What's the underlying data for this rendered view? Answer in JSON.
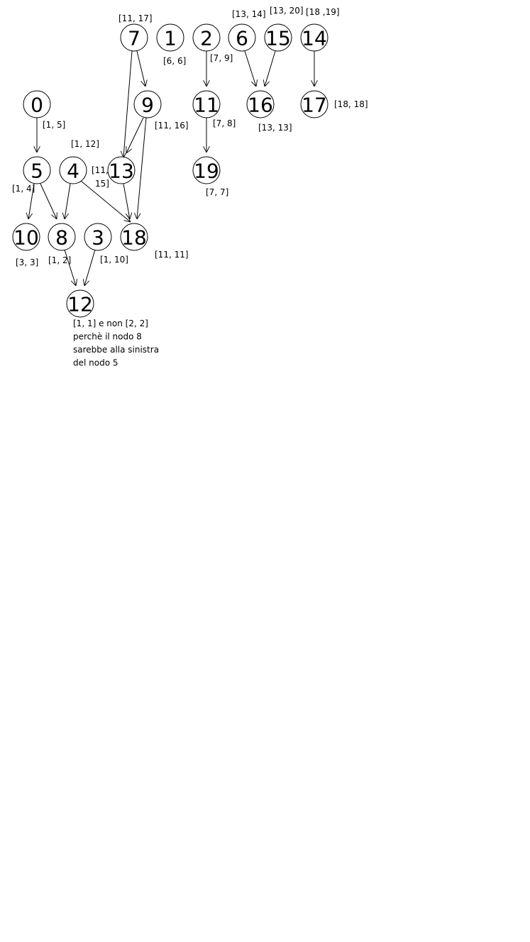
{
  "graph": {
    "nodes": [
      {
        "id": "7",
        "label": "7"
      },
      {
        "id": "1",
        "label": "1"
      },
      {
        "id": "2",
        "label": "2"
      },
      {
        "id": "6",
        "label": "6"
      },
      {
        "id": "15",
        "label": "15"
      },
      {
        "id": "14",
        "label": "14"
      },
      {
        "id": "0",
        "label": "0"
      },
      {
        "id": "9",
        "label": "9"
      },
      {
        "id": "11",
        "label": "11"
      },
      {
        "id": "16",
        "label": "16"
      },
      {
        "id": "17",
        "label": "17"
      },
      {
        "id": "5",
        "label": "5"
      },
      {
        "id": "4",
        "label": "4"
      },
      {
        "id": "13",
        "label": "13"
      },
      {
        "id": "19",
        "label": "19"
      },
      {
        "id": "10",
        "label": "10"
      },
      {
        "id": "8",
        "label": "8"
      },
      {
        "id": "3",
        "label": "3"
      },
      {
        "id": "18",
        "label": "18"
      },
      {
        "id": "12",
        "label": "12"
      }
    ],
    "edges": [
      {
        "from": "7",
        "to": "9"
      },
      {
        "from": "7",
        "to": "13"
      },
      {
        "from": "2",
        "to": "11"
      },
      {
        "from": "6",
        "to": "16"
      },
      {
        "from": "15",
        "to": "16"
      },
      {
        "from": "14",
        "to": "17"
      },
      {
        "from": "0",
        "to": "5"
      },
      {
        "from": "9",
        "to": "13"
      },
      {
        "from": "9",
        "to": "18"
      },
      {
        "from": "11",
        "to": "19"
      },
      {
        "from": "5",
        "to": "10"
      },
      {
        "from": "5",
        "to": "8"
      },
      {
        "from": "4",
        "to": "8"
      },
      {
        "from": "4",
        "to": "18"
      },
      {
        "from": "13",
        "to": "18"
      },
      {
        "from": "8",
        "to": "12"
      },
      {
        "from": "3",
        "to": "12"
      }
    ],
    "intervals": [
      {
        "node": "7",
        "text": "[11, 17]"
      },
      {
        "node": "1",
        "text": "[6, 6]"
      },
      {
        "node": "2",
        "text": "[7, 9]"
      },
      {
        "node": "6",
        "text": "[13, 14]"
      },
      {
        "node": "15",
        "text": "[13, 20]"
      },
      {
        "node": "14",
        "text": "[18 ,19]"
      },
      {
        "node": "0",
        "text": "[1, 5]"
      },
      {
        "node": "9",
        "text": "[11, 16]"
      },
      {
        "node": "11",
        "text": "[7, 8]"
      },
      {
        "node": "16",
        "text": "[13, 13]"
      },
      {
        "node": "17",
        "text": "[18, 18]"
      },
      {
        "node": "5",
        "text": "[1, 4]"
      },
      {
        "node": "4",
        "text": "[1, 12]"
      },
      {
        "node": "13",
        "text": "[11,"
      },
      {
        "node": "13",
        "text": "15]"
      },
      {
        "node": "19",
        "text": "[7, 7]"
      },
      {
        "node": "10",
        "text": "[3, 3]"
      },
      {
        "node": "8",
        "text": "[1, 2]"
      },
      {
        "node": "3",
        "text": "[1, 10]"
      },
      {
        "node": "18",
        "text": "[11, 11]"
      }
    ],
    "note": [
      "[1, 1] e non [2, 2]",
      "perchè il nodo 8",
      "sarebbe alla sinistra",
      "del nodo 5"
    ]
  }
}
